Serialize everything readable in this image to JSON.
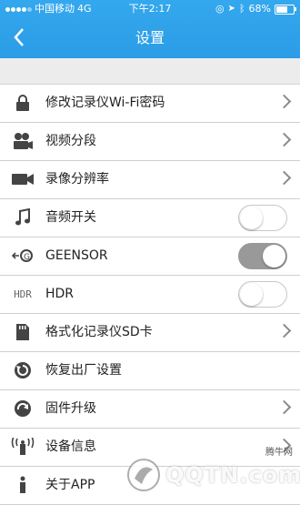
{
  "status_bar": {
    "carrier": "中国移动",
    "network": "4G",
    "time": "下午2:17",
    "battery": "68%",
    "battery_level": 0.68
  },
  "nav": {
    "back_icon": "chevron-left-icon",
    "title": "设置"
  },
  "settings": {
    "items": [
      {
        "label": "修改记录仪Wi-Fi密码",
        "icon": "lock-icon",
        "control": "chevron"
      },
      {
        "label": "视频分段",
        "icon": "camera-people-icon",
        "control": "chevron"
      },
      {
        "label": "录像分辨率",
        "icon": "video-camera-icon",
        "control": "chevron"
      },
      {
        "label": "音频开关",
        "icon": "music-note-icon",
        "control": "toggle",
        "on": false
      },
      {
        "label": "GEENSOR",
        "icon": "g-sensor-icon",
        "control": "toggle",
        "on": true
      },
      {
        "label": "HDR",
        "icon": "hdr-icon",
        "icon_text": "HDR",
        "control": "toggle",
        "on": false
      },
      {
        "label": "格式化记录仪SD卡",
        "icon": "sd-card-icon",
        "control": "chevron"
      },
      {
        "label": "恢复出厂设置",
        "icon": "reset-icon",
        "control": "none"
      },
      {
        "label": "固件升级",
        "icon": "upgrade-icon",
        "control": "chevron"
      },
      {
        "label": "设备信息",
        "icon": "device-signal-icon",
        "control": "chevron"
      },
      {
        "label": "关于APP",
        "icon": "info-icon",
        "control": "none"
      }
    ]
  },
  "watermark": {
    "brand": "QQTN.com",
    "site": "腾牛网"
  }
}
